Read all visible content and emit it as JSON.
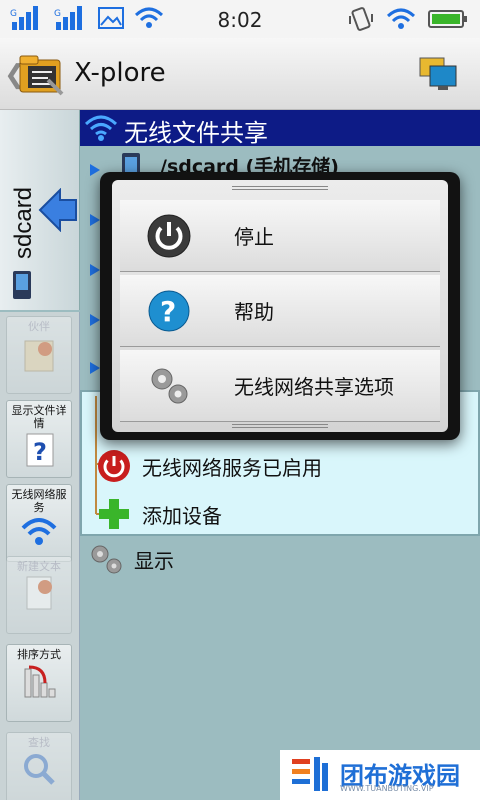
{
  "status_bar": {
    "time": "8:02",
    "left_icons": [
      "signal-icon",
      "signal-icon",
      "image-icon",
      "wifi-icon"
    ],
    "right_icons": [
      "vibrate-icon",
      "wifi-icon",
      "battery-icon"
    ]
  },
  "app": {
    "title": "X-plore",
    "back_glyph": "❮"
  },
  "left_tab": {
    "label": "sdcard"
  },
  "toolbar": [
    {
      "label": "伙伴",
      "icon": "new-folder-icon",
      "enabled": false
    },
    {
      "label": "显示文件详情",
      "icon": "file-details-icon",
      "enabled": true
    },
    {
      "label": "无线网络服务",
      "icon": "wifi-icon",
      "enabled": true
    },
    {
      "label": "新建文本",
      "icon": "new-text-icon",
      "enabled": false
    },
    {
      "label": "排序方式",
      "icon": "sort-icon",
      "enabled": true
    },
    {
      "label": "查找",
      "icon": "search-icon",
      "enabled": false
    }
  ],
  "content": {
    "header": "无线文件共享",
    "sdcard_row": "/sdcard (手机存储)",
    "wifi_service": "无线网络服务已启用",
    "add_device": "添加设备",
    "display": "显示"
  },
  "popup": {
    "items": [
      {
        "label": "停止",
        "icon": "power-icon"
      },
      {
        "label": "帮助",
        "icon": "help-icon"
      },
      {
        "label": "无线网络共享选项",
        "icon": "gears-icon"
      }
    ]
  },
  "watermark": {
    "text": "团布游戏园",
    "sub": "WWW.TUANBUTING.VIP"
  },
  "colors": {
    "header_bg": "#0d1b86",
    "content_bg": "#9cbcc0",
    "wifi_panel_bg": "#d9f6fb",
    "accent_blue": "#1e6fe0",
    "power_red": "#c81e1e",
    "add_green": "#3ab52a"
  }
}
